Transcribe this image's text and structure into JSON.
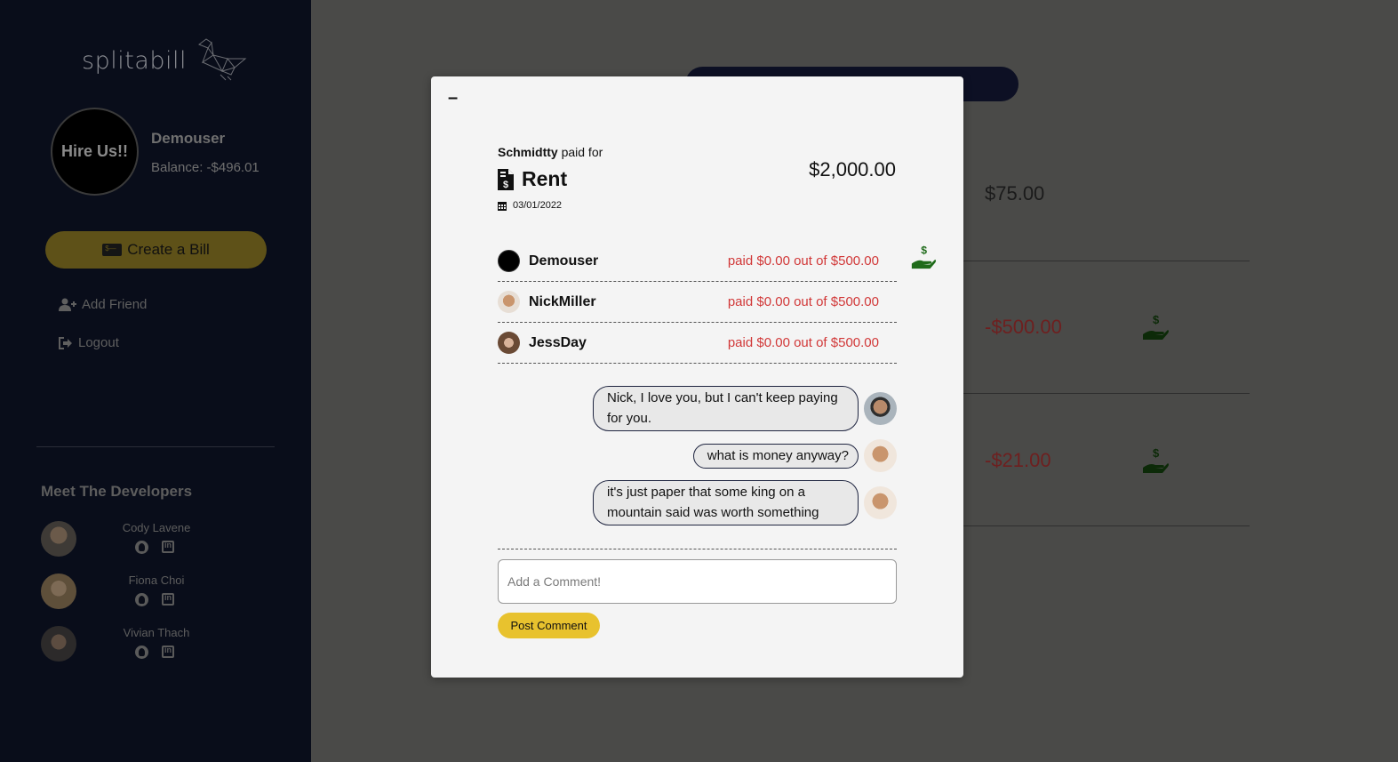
{
  "sidebar": {
    "logo_text": "splitabill",
    "avatar_text": "Hire Us!!",
    "user_name": "Demouser",
    "balance": "Balance: -$496.01",
    "create_bill": "Create a Bill",
    "add_friend": "Add Friend",
    "logout": "Logout",
    "devs_title": "Meet The Developers",
    "developers": [
      {
        "name": "Cody Lavene"
      },
      {
        "name": "Fiona Choi"
      },
      {
        "name": "Vivian Thach"
      }
    ]
  },
  "background": {
    "amounts": [
      "$75.00",
      "-$500.00",
      "-$21.00"
    ]
  },
  "modal": {
    "close_label": "–",
    "payer": "Schmidtty",
    "paid_for": " paid for",
    "bill_name": "Rent",
    "date": "03/01/2022",
    "total": "$2,000.00",
    "splits": [
      {
        "name": "Demouser",
        "status": "paid $0.00 out of $500.00"
      },
      {
        "name": "NickMiller",
        "status": "paid $0.00 out of $500.00"
      },
      {
        "name": "JessDay",
        "status": "paid $0.00 out of $500.00"
      }
    ],
    "comments": [
      {
        "text": "Nick, I love you, but I can't keep paying for you."
      },
      {
        "text": "what is money anyway?"
      },
      {
        "text": "it's just paper that some king on a mountain said was worth something"
      }
    ],
    "comment_placeholder": "Add a Comment!",
    "post_label": "Post Comment"
  },
  "colors": {
    "sidebar_bg": "#090d1a",
    "accent_yellow": "#e8c22e",
    "owed_red": "#d13838",
    "pay_green": "#1f6b1a"
  }
}
